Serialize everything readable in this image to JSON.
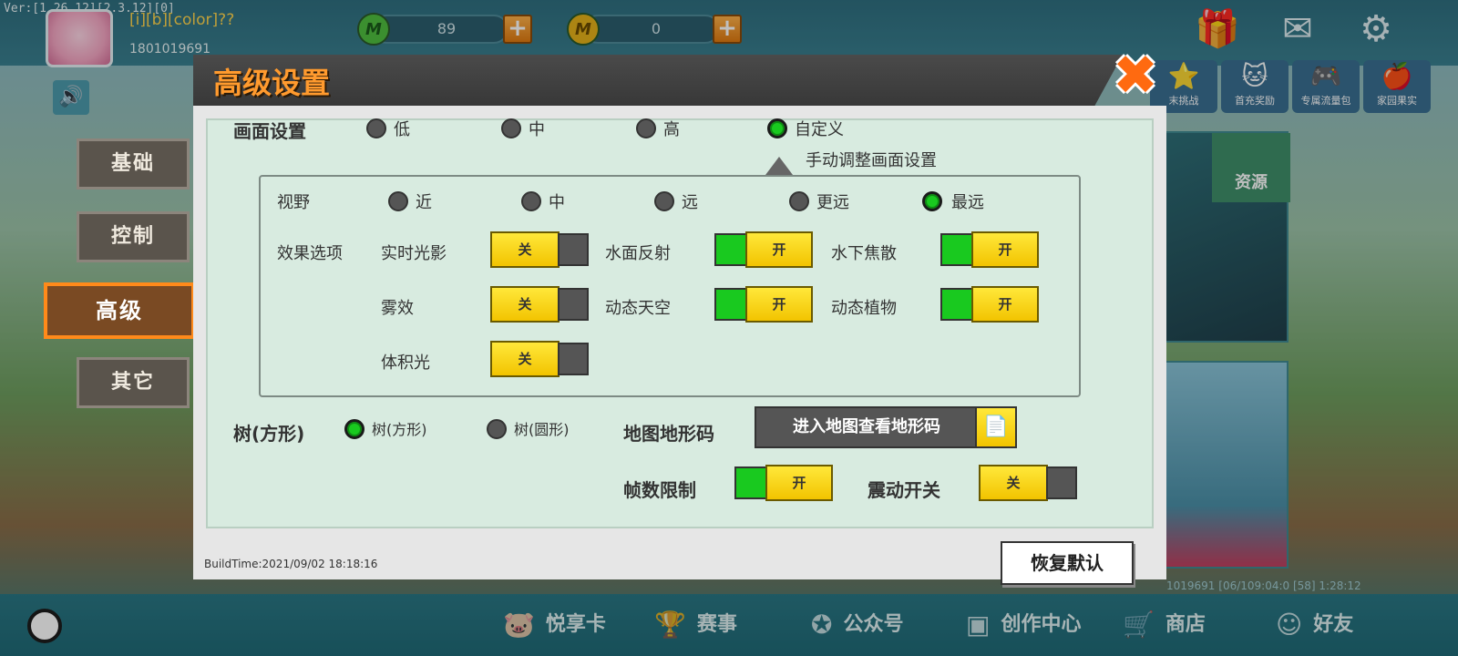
{
  "version": "Ver:[1.26.12][2.3.12][0]",
  "user": {
    "name": "[i][b][color]??",
    "id": "1801019691"
  },
  "currency": [
    {
      "symbol": "M",
      "value": "89",
      "color": "#4fbf3f"
    },
    {
      "symbol": "M",
      "value": "0",
      "color": "#e6b21a"
    }
  ],
  "top_icons": [
    "gift-icon",
    "mail-icon",
    "gear-icon"
  ],
  "events": [
    {
      "label": "末挑战",
      "icon": "star-icon"
    },
    {
      "label": "首充奖励",
      "icon": "cat-icon"
    },
    {
      "label": "专属流量包",
      "icon": "gamepad-icon"
    },
    {
      "label": "家园果实",
      "icon": "fruit-icon"
    }
  ],
  "side_tabs": [
    {
      "label": "基础",
      "active": false
    },
    {
      "label": "控制",
      "active": false
    },
    {
      "label": "高级",
      "active": true
    },
    {
      "label": "其它",
      "active": false
    }
  ],
  "dialog": {
    "title": "高级设置",
    "graphics": {
      "label": "画面设置",
      "options": [
        "低",
        "中",
        "高",
        "自定义"
      ],
      "selected": "自定义",
      "hint": "手动调整画面设置"
    },
    "view": {
      "label": "视野",
      "options": [
        "近",
        "中",
        "远",
        "更远",
        "最远"
      ],
      "selected": "最远"
    },
    "effects": {
      "label": "效果选项",
      "on_text": "开",
      "off_text": "关",
      "items": [
        {
          "label": "实时光影",
          "on": false
        },
        {
          "label": "水面反射",
          "on": true
        },
        {
          "label": "水下焦散",
          "on": true
        },
        {
          "label": "雾效",
          "on": false
        },
        {
          "label": "动态天空",
          "on": true
        },
        {
          "label": "动态植物",
          "on": true
        },
        {
          "label": "体积光",
          "on": false
        }
      ]
    },
    "tree": {
      "label": "树(方形)",
      "options": [
        "树(方形)",
        "树(圆形)"
      ],
      "selected": "树(方形)"
    },
    "map_code": {
      "label": "地图地形码",
      "button": "进入地图查看地形码"
    },
    "fps_limit": {
      "label": "帧数限制",
      "on": true,
      "text": "开"
    },
    "vibration": {
      "label": "震动开关",
      "on": false,
      "text": "关"
    },
    "build_time": "BuildTime:2021/09/02 18:18:16",
    "reset_button": "恢复默认"
  },
  "right_panel": {
    "label": "资源",
    "footer": "1019691   [06/109:04:0  [58] 1:28:12"
  },
  "bottom_nav": [
    {
      "label": "悦享卡",
      "icon": "pig-icon"
    },
    {
      "label": "赛事",
      "icon": "trophy-icon"
    },
    {
      "label": "公众号",
      "icon": "star-badge-icon"
    },
    {
      "label": "创作中心",
      "icon": "cube-icon"
    },
    {
      "label": "商店",
      "icon": "cart-icon"
    },
    {
      "label": "好友",
      "icon": "friend-icon"
    }
  ]
}
